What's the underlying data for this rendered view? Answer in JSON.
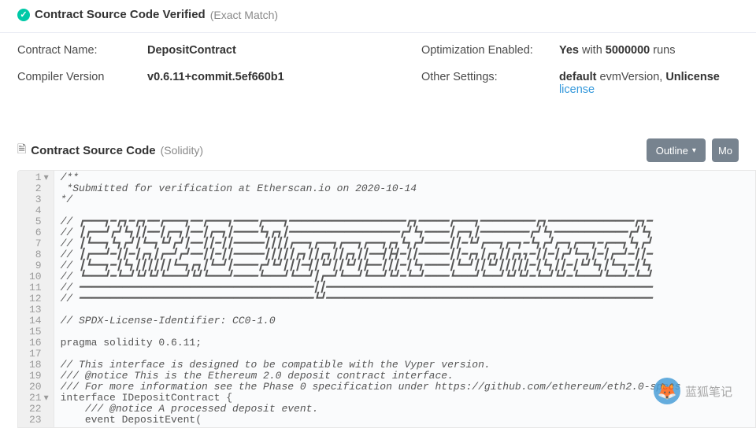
{
  "header": {
    "verified_label": "Contract Source Code Verified",
    "verified_sub": "(Exact Match)"
  },
  "info": {
    "contract_name_label": "Contract Name:",
    "contract_name_value": "DepositContract",
    "optimization_label": "Optimization Enabled:",
    "optimization_yes": "Yes",
    "optimization_with": " with ",
    "optimization_runs": "5000000",
    "optimization_runs_suffix": " runs",
    "compiler_label": "Compiler Version",
    "compiler_value": "v0.6.11+commit.5ef660b1",
    "other_settings_label": "Other Settings:",
    "other_default": "default",
    "other_evm": " evmVersion, ",
    "other_unlicense": "Unlicense",
    "other_license": "license"
  },
  "source": {
    "title": "Contract Source Code",
    "sub": "(Solidity)",
    "outline_btn": "Outline",
    "more_btn": "Mo"
  },
  "code": {
    "lines": [
      "/**",
      " *Submitted for verification at Etherscan.io on 2020-10-14",
      "*/",
      "",
      "// ┏━━━┓━┏┓━┏┓━━┏━━━┓━━┏━━━┓━━━━┏━━━┓━━━━━━━━━━━━━━━━━━━┏┓━━━━━┏━━━┓━━━━━━━━━┏┓━━━━━━━━━━━━━━┏┓━",
      "// ┃┏━━┛┏┛┗┓┃┃━━┃┏━┓┃━━┃┏━┓┃━━━━┗┓┏┓┃━━━━━━━━━━━━━━━━━━┏┛┗┓━━━━┃┏━┓┃━━━━━━━━┏┛┗┓━━━━━━━━━━━━┏┛┗┓",
      "// ┃┗━━┓┗┓┏┛┃┗━┓┗┛┏┛┃━━┃┃━┃┃━━━━━┃┃┃┃┏━━┓┏━━┓┏━━┓┏━━┓┏┓┗┓┏┛━━━━┃┃━┗┛┏━━┓┏━┓━┗┓┏┛┏━┓┏━━┓━┏━━┓┗┓┏┛",
      "// ┃┏━━┛━┃┃━┃┏┓┃┏━┛┏┛━━┃┃━┃┃━━━━━┃┃┃┃┃┏┓┃┃┏┓┃┃┏┓┃┃━━┫┣┫━┃┃━━━━━┃┃━┏┓┃┏┓┃┃┏┓┓━┃┃━┃┏┛┗━┓┃━┃┏━┛━┃┃━",
      "// ┃┗━━┓━┃┗┓┃┃┃┃┃┃┗━┓┏┓┃┗━┛┃━━━━┏┛┗┛┃┃┃━┫┃┗┛┃┃┗┛┃┣━━┃┃┃━┃┗┓━━━━┃┗━┛┃┃┗┛┃┃┃┃┃━┃┗┓┃┃━┃┗┛┗┓┃┗━┓━┃┗┓",
      "// ┗━━━┛━┗━┛┗┛┗┛┗━━━┛┗┛┗━━━┛━━━━┗━━━┛┗━━┛┃┏━┛┗━━┛┗━━┛┗┛━┗━┛━━━━┗━━━┛┗━━┛┗┛┗┛━┗━┛┗┛━┗━━━┛┗━━┛━┗━┛",
      "// ━━━━━━━━━━━━━━━━━━━━━━━━━━━━━━━━━━━━━━┃┃━━━━━━━━━━━━━━━━━━━━━━━━━━━━━━━━━━━━━━━━━━━━━━━━━━━━━",
      "// ━━━━━━━━━━━━━━━━━━━━━━━━━━━━━━━━━━━━━━┗┛━━━━━━━━━━━━━━━━━━━━━━━━━━━━━━━━━━━━━━━━━━━━━━━━━━━━━",
      "",
      "// SPDX-License-Identifier: CC0-1.0",
      "",
      "pragma solidity 0.6.11;",
      "",
      "// This interface is designed to be compatible with the Vyper version.",
      "/// @notice This is the Ethereum 2.0 deposit contract interface.",
      "/// For more information see the Phase 0 specification under https://github.com/ethereum/eth2.0-specs",
      "interface IDepositContract {",
      "    /// @notice A processed deposit event.",
      "    event DepositEvent("
    ]
  },
  "watermark": {
    "text": "蓝狐笔记"
  }
}
